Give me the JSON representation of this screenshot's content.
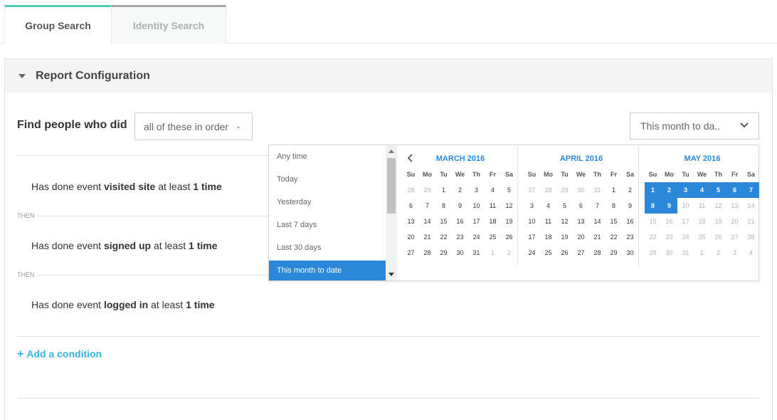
{
  "tabs": [
    {
      "label": "Group Search",
      "active": true
    },
    {
      "label": "Identity Search",
      "active": false
    }
  ],
  "panel": {
    "title": "Report Configuration"
  },
  "query": {
    "find_label": "Find people who did",
    "order_value": "all of these in order",
    "date_value": "This month to da.."
  },
  "conditions": [
    {
      "prefix": "Has done event",
      "event": "visited site",
      "middle": "at least",
      "count": "1 time"
    },
    {
      "prefix": "Has done event",
      "event": "signed up",
      "middle": "at least",
      "count": "1 time"
    },
    {
      "prefix": "Has done event",
      "event": "logged in",
      "middle": "at least",
      "count": "1 time"
    }
  ],
  "then_label": "THEN",
  "add_condition": {
    "icon": "plus-icon",
    "label": "Add a condition"
  },
  "date_picker": {
    "presets": [
      "Any time",
      "Today",
      "Yesterday",
      "Last 7 days",
      "Last 30 days",
      "This month to date"
    ],
    "selected_preset": "This month to date",
    "weekdays": [
      "Su",
      "Mo",
      "Tu",
      "We",
      "Th",
      "Fr",
      "Sa"
    ],
    "months": [
      {
        "title": "MARCH 2016",
        "days": [
          {
            "d": "28",
            "m": true
          },
          {
            "d": "29",
            "m": true
          },
          {
            "d": "1"
          },
          {
            "d": "2"
          },
          {
            "d": "3"
          },
          {
            "d": "4"
          },
          {
            "d": "5"
          },
          {
            "d": "6"
          },
          {
            "d": "7"
          },
          {
            "d": "8"
          },
          {
            "d": "9"
          },
          {
            "d": "10"
          },
          {
            "d": "11"
          },
          {
            "d": "12"
          },
          {
            "d": "13"
          },
          {
            "d": "14"
          },
          {
            "d": "15"
          },
          {
            "d": "16"
          },
          {
            "d": "17"
          },
          {
            "d": "18"
          },
          {
            "d": "19"
          },
          {
            "d": "20"
          },
          {
            "d": "21"
          },
          {
            "d": "22"
          },
          {
            "d": "23"
          },
          {
            "d": "24"
          },
          {
            "d": "25"
          },
          {
            "d": "26"
          },
          {
            "d": "27"
          },
          {
            "d": "28"
          },
          {
            "d": "29"
          },
          {
            "d": "30"
          },
          {
            "d": "31"
          },
          {
            "d": "1",
            "m": true
          },
          {
            "d": "2",
            "m": true
          }
        ]
      },
      {
        "title": "APRIL 2016",
        "days": [
          {
            "d": "27",
            "m": true
          },
          {
            "d": "28",
            "m": true
          },
          {
            "d": "29",
            "m": true
          },
          {
            "d": "30",
            "m": true
          },
          {
            "d": "31",
            "m": true
          },
          {
            "d": "1"
          },
          {
            "d": "2"
          },
          {
            "d": "3"
          },
          {
            "d": "4"
          },
          {
            "d": "5"
          },
          {
            "d": "6"
          },
          {
            "d": "7"
          },
          {
            "d": "8"
          },
          {
            "d": "9"
          },
          {
            "d": "10"
          },
          {
            "d": "11"
          },
          {
            "d": "12"
          },
          {
            "d": "13"
          },
          {
            "d": "14"
          },
          {
            "d": "15"
          },
          {
            "d": "16"
          },
          {
            "d": "17"
          },
          {
            "d": "18"
          },
          {
            "d": "19"
          },
          {
            "d": "20"
          },
          {
            "d": "21"
          },
          {
            "d": "22"
          },
          {
            "d": "23"
          },
          {
            "d": "24"
          },
          {
            "d": "25"
          },
          {
            "d": "26"
          },
          {
            "d": "27"
          },
          {
            "d": "28"
          },
          {
            "d": "29"
          },
          {
            "d": "30"
          }
        ]
      },
      {
        "title": "MAY 2016",
        "days": [
          {
            "d": "1",
            "s": true
          },
          {
            "d": "2",
            "s": true
          },
          {
            "d": "3",
            "s": true
          },
          {
            "d": "4",
            "s": true
          },
          {
            "d": "5",
            "s": true
          },
          {
            "d": "6",
            "s": true
          },
          {
            "d": "7",
            "s": true
          },
          {
            "d": "8",
            "s": true
          },
          {
            "d": "9",
            "s": true
          },
          {
            "d": "10",
            "m": true
          },
          {
            "d": "11",
            "m": true
          },
          {
            "d": "12",
            "m": true
          },
          {
            "d": "13",
            "m": true
          },
          {
            "d": "14",
            "m": true
          },
          {
            "d": "15",
            "m": true
          },
          {
            "d": "16",
            "m": true
          },
          {
            "d": "17",
            "m": true
          },
          {
            "d": "18",
            "m": true
          },
          {
            "d": "19",
            "m": true
          },
          {
            "d": "20",
            "m": true
          },
          {
            "d": "21",
            "m": true
          },
          {
            "d": "22",
            "m": true
          },
          {
            "d": "23",
            "m": true
          },
          {
            "d": "24",
            "m": true
          },
          {
            "d": "25",
            "m": true
          },
          {
            "d": "26",
            "m": true
          },
          {
            "d": "27",
            "m": true
          },
          {
            "d": "28",
            "m": true
          },
          {
            "d": "29",
            "m": true
          },
          {
            "d": "30",
            "m": true
          },
          {
            "d": "31",
            "m": true
          },
          {
            "d": "1",
            "m": true
          },
          {
            "d": "2",
            "m": true
          },
          {
            "d": "3",
            "m": true
          },
          {
            "d": "4",
            "m": true
          }
        ]
      }
    ]
  },
  "colors": {
    "accent": "#2b88d9",
    "tab_active": "#4fcfb1",
    "link": "#3bb3d9"
  }
}
